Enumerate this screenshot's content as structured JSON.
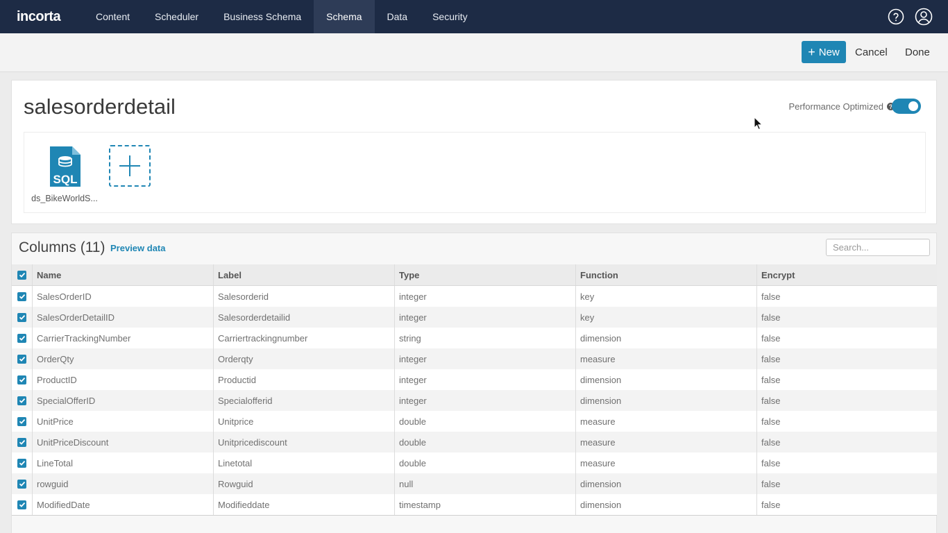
{
  "nav": {
    "logo": "incorta",
    "items": [
      {
        "label": "Content",
        "active": false
      },
      {
        "label": "Scheduler",
        "active": false
      },
      {
        "label": "Business Schema",
        "active": false
      },
      {
        "label": "Schema",
        "active": true
      },
      {
        "label": "Data",
        "active": false
      },
      {
        "label": "Security",
        "active": false
      }
    ],
    "icons": [
      "help-circle-icon",
      "user-account-icon"
    ]
  },
  "toolbar": {
    "new_label": "New",
    "cancel_label": "Cancel",
    "done_label": "Done"
  },
  "table": {
    "name": "salesorderdetail",
    "perf_label": "Performance Optimized",
    "perf_enabled": true,
    "datasource_label": "ds_BikeWorldS...",
    "datasource_icon": "sql-file-icon"
  },
  "columns": {
    "title": "Columns (11)",
    "preview_label": "Preview data",
    "search_placeholder": "Search...",
    "headers": [
      "Name",
      "Label",
      "Type",
      "Function",
      "Encrypt"
    ],
    "rows": [
      {
        "name": "SalesOrderID",
        "label": "Salesorderid",
        "type": "integer",
        "function": "key",
        "encrypt": "false"
      },
      {
        "name": "SalesOrderDetailID",
        "label": "Salesorderdetailid",
        "type": "integer",
        "function": "key",
        "encrypt": "false"
      },
      {
        "name": "CarrierTrackingNumber",
        "label": "Carriertrackingnumber",
        "type": "string",
        "function": "dimension",
        "encrypt": "false"
      },
      {
        "name": "OrderQty",
        "label": "Orderqty",
        "type": "integer",
        "function": "measure",
        "encrypt": "false"
      },
      {
        "name": "ProductID",
        "label": "Productid",
        "type": "integer",
        "function": "dimension",
        "encrypt": "false"
      },
      {
        "name": "SpecialOfferID",
        "label": "Specialofferid",
        "type": "integer",
        "function": "dimension",
        "encrypt": "false"
      },
      {
        "name": "UnitPrice",
        "label": "Unitprice",
        "type": "double",
        "function": "measure",
        "encrypt": "false"
      },
      {
        "name": "UnitPriceDiscount",
        "label": "Unitpricediscount",
        "type": "double",
        "function": "measure",
        "encrypt": "false"
      },
      {
        "name": "LineTotal",
        "label": "Linetotal",
        "type": "double",
        "function": "measure",
        "encrypt": "false"
      },
      {
        "name": "rowguid",
        "label": "Rowguid",
        "type": "null",
        "function": "dimension",
        "encrypt": "false"
      },
      {
        "name": "ModifiedDate",
        "label": "Modifieddate",
        "type": "timestamp",
        "function": "dimension",
        "encrypt": "false"
      }
    ]
  },
  "colors": {
    "nav_bg": "#1d2b45",
    "accent": "#1f86b4"
  }
}
